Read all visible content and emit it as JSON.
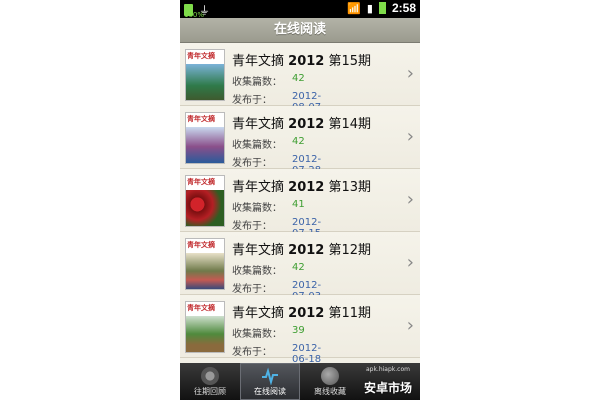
{
  "status": {
    "battery": "100%",
    "time": "2:58"
  },
  "header": {
    "title": "在线阅读"
  },
  "list": {
    "items": [
      {
        "mag": "青年文摘",
        "year": "2012",
        "issue": "第15期",
        "count_label": "收集篇数：",
        "count": "42",
        "date_label": "发布于：",
        "date": "2012-08-07"
      },
      {
        "mag": "青年文摘",
        "year": "2012",
        "issue": "第14期",
        "count_label": "收集篇数：",
        "count": "42",
        "date_label": "发布于：",
        "date": "2012-07-28"
      },
      {
        "mag": "青年文摘",
        "year": "2012",
        "issue": "第13期",
        "count_label": "收集篇数：",
        "count": "41",
        "date_label": "发布于：",
        "date": "2012-07-15"
      },
      {
        "mag": "青年文摘",
        "year": "2012",
        "issue": "第12期",
        "count_label": "收集篇数：",
        "count": "42",
        "date_label": "发布于：",
        "date": "2012-07-03"
      },
      {
        "mag": "青年文摘",
        "year": "2012",
        "issue": "第11期",
        "count_label": "收集篇数：",
        "count": "39",
        "date_label": "发布于：",
        "date": "2012-06-18"
      }
    ]
  },
  "tabs": [
    {
      "label": "往期回顾",
      "icon": "history-icon"
    },
    {
      "label": "在线阅读",
      "icon": "pulse-icon"
    },
    {
      "label": "离线收藏",
      "icon": "globe-icon"
    }
  ],
  "watermark": {
    "text": "安卓市场",
    "small": "apk.hiapk.com"
  },
  "colors": {
    "count": "#3e9e32",
    "date": "#3b63a8",
    "title_bar": "#a6a699"
  }
}
